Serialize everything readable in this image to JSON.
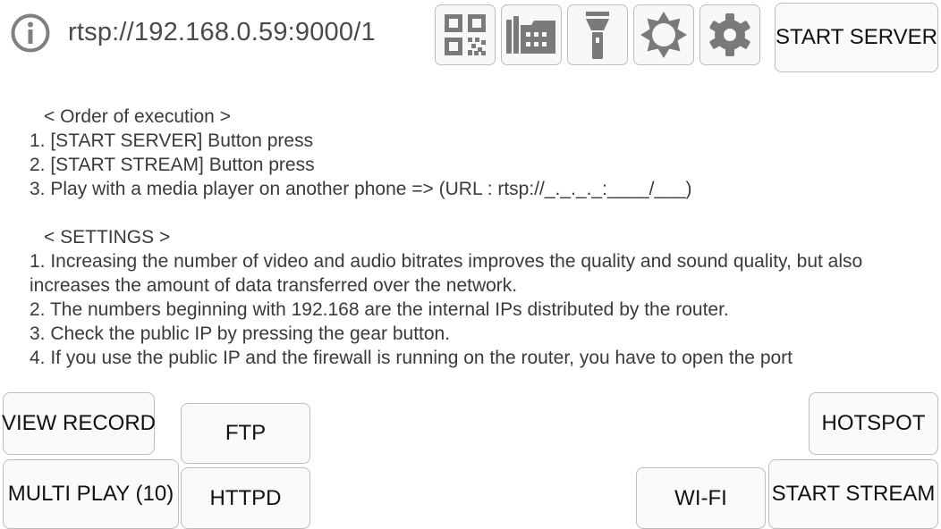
{
  "header": {
    "url": "rtsp://192.168.0.59:9000/1",
    "icons": [
      "info-icon",
      "qr-code-icon",
      "files-icon",
      "flashlight-icon",
      "brightness-icon",
      "settings-gear-icon"
    ],
    "start_server_label": "START SERVER"
  },
  "instructions": {
    "order_heading": "< Order of execution >",
    "order_steps": [
      "1. [START SERVER] Button press",
      "2. [START STREAM] Button press",
      "3. Play with a media player on another phone => (URL : rtsp://_._._._:____/___)"
    ],
    "settings_heading": "< SETTINGS >",
    "settings_items": [
      "1. Increasing the number of video and audio bitrates improves the quality and sound quality, but also increases the amount of data transferred over the network.",
      "2. The numbers beginning with 192.168 are the internal IPs distributed by the router.",
      "3. Check the public IP by pressing the gear button.",
      "4. If you use the public IP and the firewall is running on the router, you have to open the port"
    ]
  },
  "bottom": {
    "view_record": "VIEW RECORD",
    "ftp": "FTP",
    "multi_play": "MULTI PLAY (10)",
    "httpd": "HTTPD",
    "hotspot": "HOTSPOT",
    "wifi": "WI-FI",
    "start_stream": "START STREAM"
  },
  "colors": {
    "icon_gray": "#7a7a7a",
    "button_border": "#bdbdbd",
    "button_bg": "#fafafa",
    "text": "#3a3a3a"
  }
}
